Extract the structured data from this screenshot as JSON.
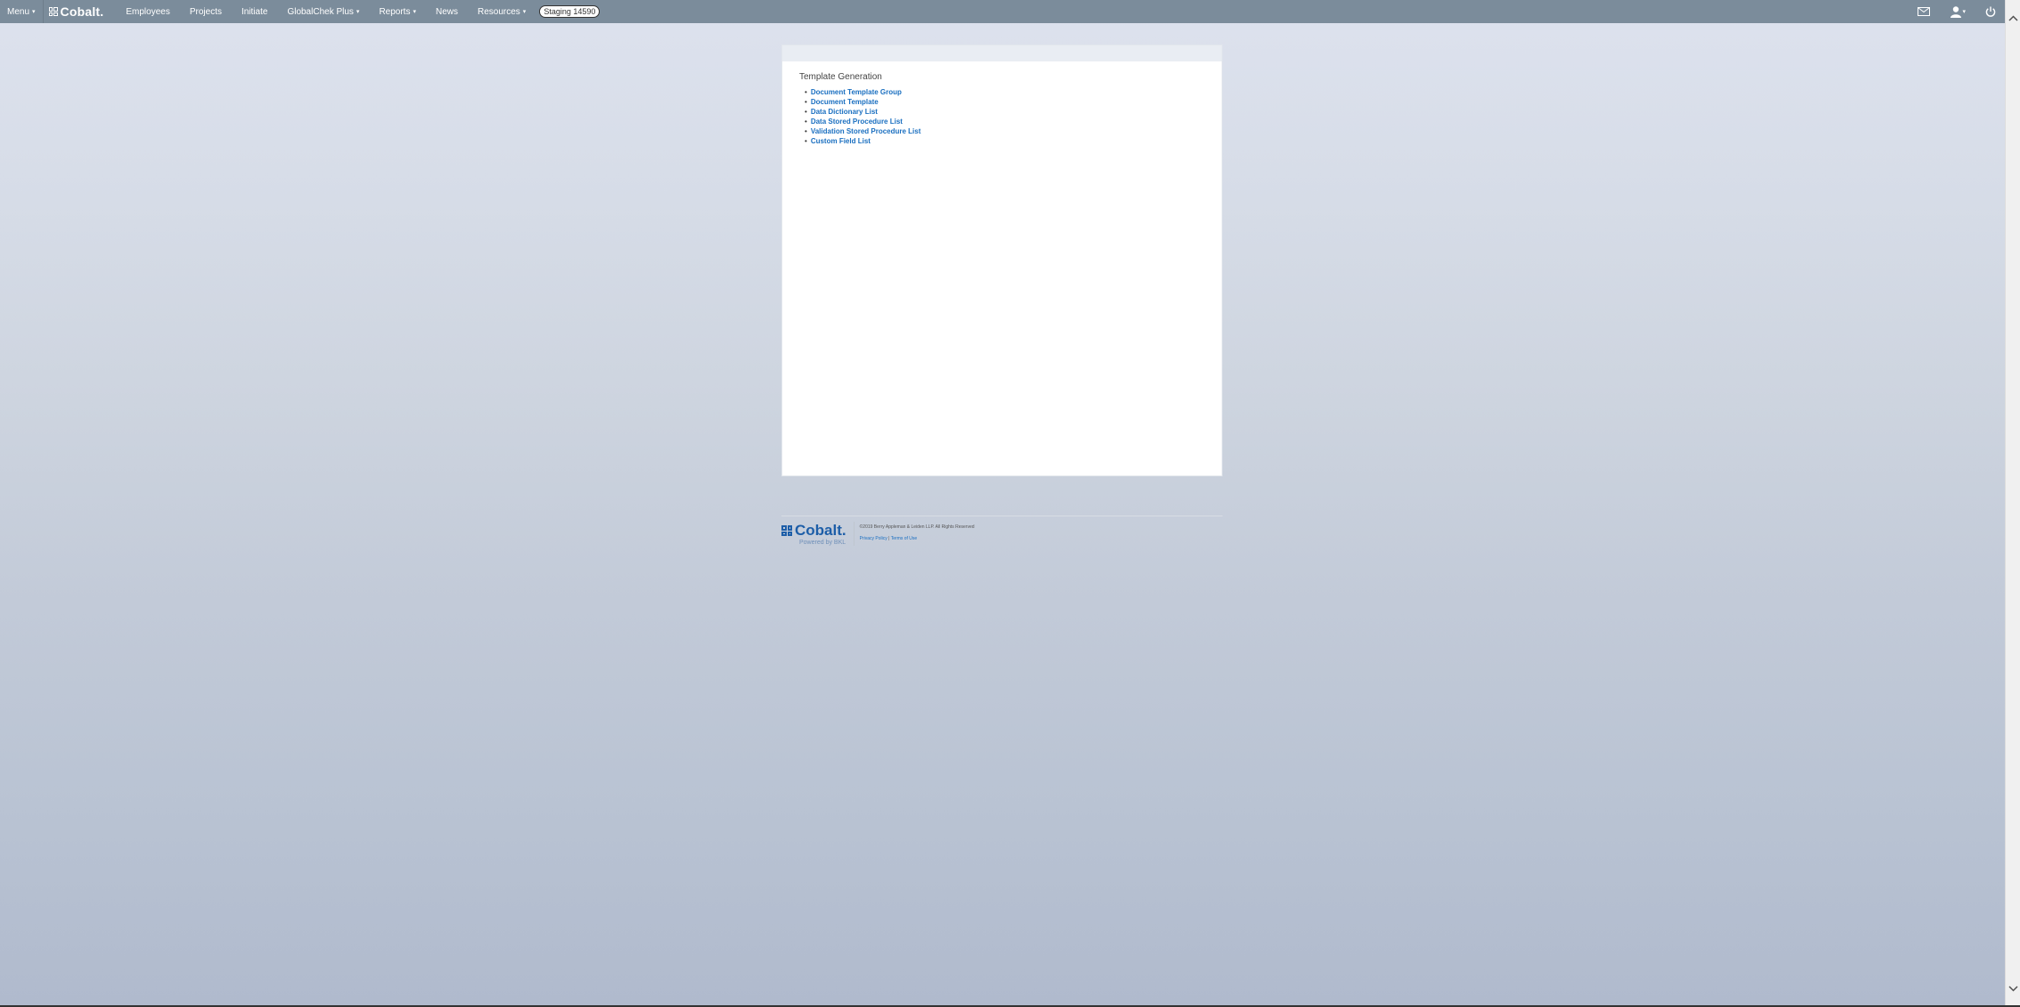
{
  "topbar": {
    "menu_label": "Menu",
    "logo_text": "Cobalt.",
    "nav": {
      "employees": "Employees",
      "projects": "Projects",
      "initiate": "Initiate",
      "globalcheck": "GlobalChek Plus",
      "reports": "Reports",
      "news": "News",
      "resources": "Resources"
    },
    "env_badge": "Staging 14590"
  },
  "content": {
    "title": "Template Generation",
    "links": [
      "Document Template Group",
      "Document Template",
      "Data Dictionary List",
      "Data Stored Procedure List",
      "Validation Stored Procedure List",
      "Custom Field List"
    ]
  },
  "footer": {
    "logo_text": "Cobalt.",
    "powered": "Powered by BKL",
    "copyright": "©2019 Berry Appleman & Leiden LLP. All Rights Reserved",
    "privacy": "Privacy Policy",
    "separator": "|",
    "terms": "Terms of Use"
  },
  "icons": {
    "menu_caret": "chevron-down-icon",
    "mail": "mail-icon",
    "user": "user-icon",
    "power": "power-icon",
    "scroll_up": "chevron-up-icon",
    "scroll_down": "chevron-down-icon"
  }
}
